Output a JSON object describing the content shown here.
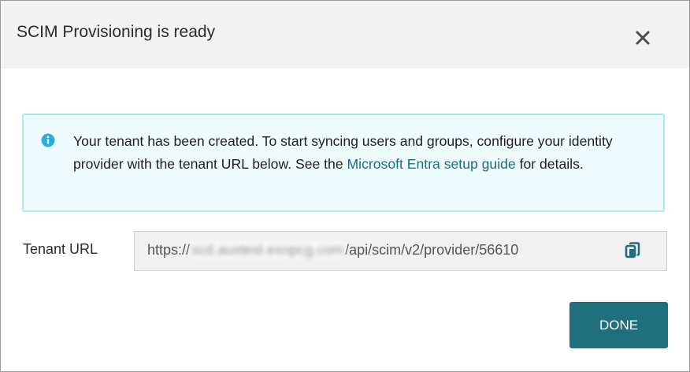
{
  "dialog": {
    "title": "SCIM Provisioning is ready",
    "close_icon": "close-icon"
  },
  "info": {
    "icon": "info-icon",
    "text_before_link": "Your tenant has been created. To start syncing users and groups, configure your identity provider with the tenant URL below. See the ",
    "link_text": "Microsoft Entra setup guide",
    "text_after_link": " for details."
  },
  "tenant": {
    "label": "Tenant URL",
    "url_prefix": "https://",
    "url_redacted": "scd.auxtest.exopcg.com",
    "url_suffix": "/api/scim/v2/provider/56610",
    "copy_icon": "copy-icon"
  },
  "actions": {
    "done_label": "DONE"
  },
  "colors": {
    "accent": "#1f6f7d",
    "link": "#1f6b7c",
    "info_background": "#eefbfd",
    "info_border": "#aee6ef",
    "header_background": "#f2f2f2"
  }
}
